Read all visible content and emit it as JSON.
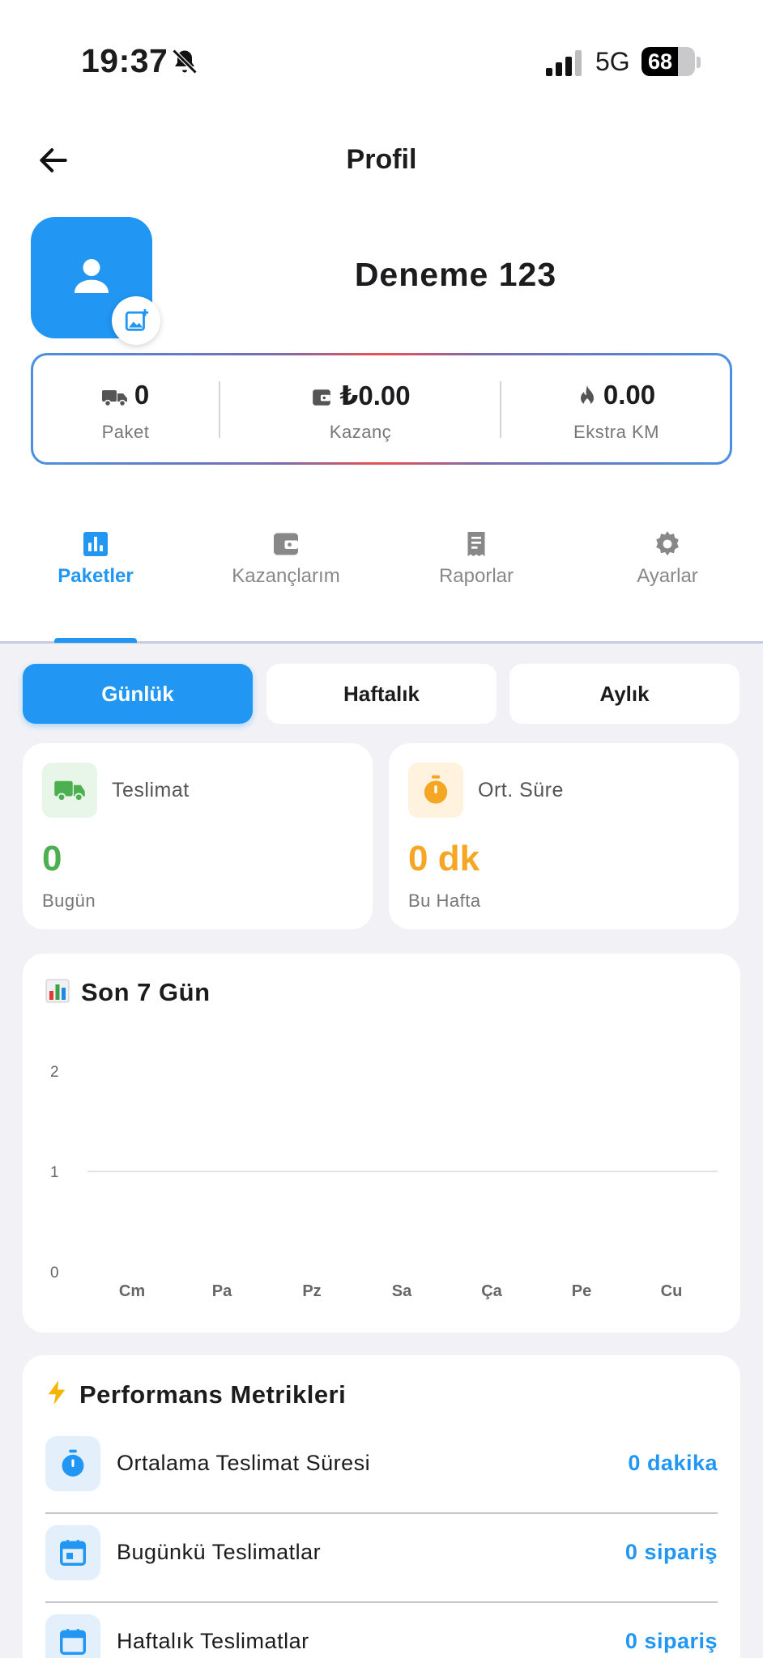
{
  "status_bar": {
    "time": "19:37",
    "network": "5G",
    "battery": "68",
    "battery_level": 0.68
  },
  "header": {
    "title": "Profil"
  },
  "profile": {
    "name": "Deneme 123"
  },
  "stats": [
    {
      "icon": "truck-icon",
      "value": "0",
      "label": "Paket"
    },
    {
      "icon": "wallet-icon",
      "value": "₺0.00",
      "label": "Kazanç"
    },
    {
      "icon": "flame-icon",
      "value": "0.00",
      "label": "Ekstra KM"
    }
  ],
  "tabs": [
    {
      "label": "Paketler",
      "icon": "bar-chart-icon",
      "active": true
    },
    {
      "label": "Kazançlarım",
      "icon": "wallet-icon",
      "active": false
    },
    {
      "label": "Raporlar",
      "icon": "receipt-icon",
      "active": false
    },
    {
      "label": "Ayarlar",
      "icon": "gear-icon",
      "active": false
    }
  ],
  "periods": [
    {
      "label": "Günlük",
      "active": true
    },
    {
      "label": "Haftalık",
      "active": false
    },
    {
      "label": "Aylık",
      "active": false
    }
  ],
  "metric_cards": [
    {
      "icon": "truck-icon",
      "title": "Teslimat",
      "value": "0",
      "subtitle": "Bugün",
      "accent": "#4caf50",
      "icon_bg": "#e8f5e9"
    },
    {
      "icon": "stopwatch-icon",
      "title": "Ort. Süre",
      "value": "0 dk",
      "subtitle": "Bu Hafta",
      "accent": "#f5a623",
      "icon_bg": "#fff3e0"
    }
  ],
  "chart_section": {
    "emoji": "bar-chart-emoji",
    "title": "Son 7 Gün"
  },
  "chart_data": {
    "type": "bar",
    "categories": [
      "Cm",
      "Pa",
      "Pz",
      "Sa",
      "Ça",
      "Pe",
      "Cu"
    ],
    "values": [
      0,
      0,
      0,
      0,
      0,
      0,
      0
    ],
    "yticks": [
      "0",
      "1",
      "2"
    ],
    "ylim": [
      0,
      2
    ],
    "grid": "horizontal line at 1",
    "title": "",
    "xlabel": "",
    "ylabel": ""
  },
  "performance": {
    "emoji": "lightning-emoji",
    "title": "Performans Metrikleri",
    "rows": [
      {
        "icon": "stopwatch-icon",
        "label": "Ortalama Teslimat Süresi",
        "value": "0 dakika"
      },
      {
        "icon": "calendar-today-icon",
        "label": "Bugünkü Teslimatlar",
        "value": "0 sipariş"
      },
      {
        "icon": "calendar-icon",
        "label": "Haftalık Teslimatlar",
        "value": "0 sipariş"
      }
    ]
  },
  "colors": {
    "accent": "#2196f3",
    "green": "#4caf50",
    "orange": "#f5a623"
  }
}
